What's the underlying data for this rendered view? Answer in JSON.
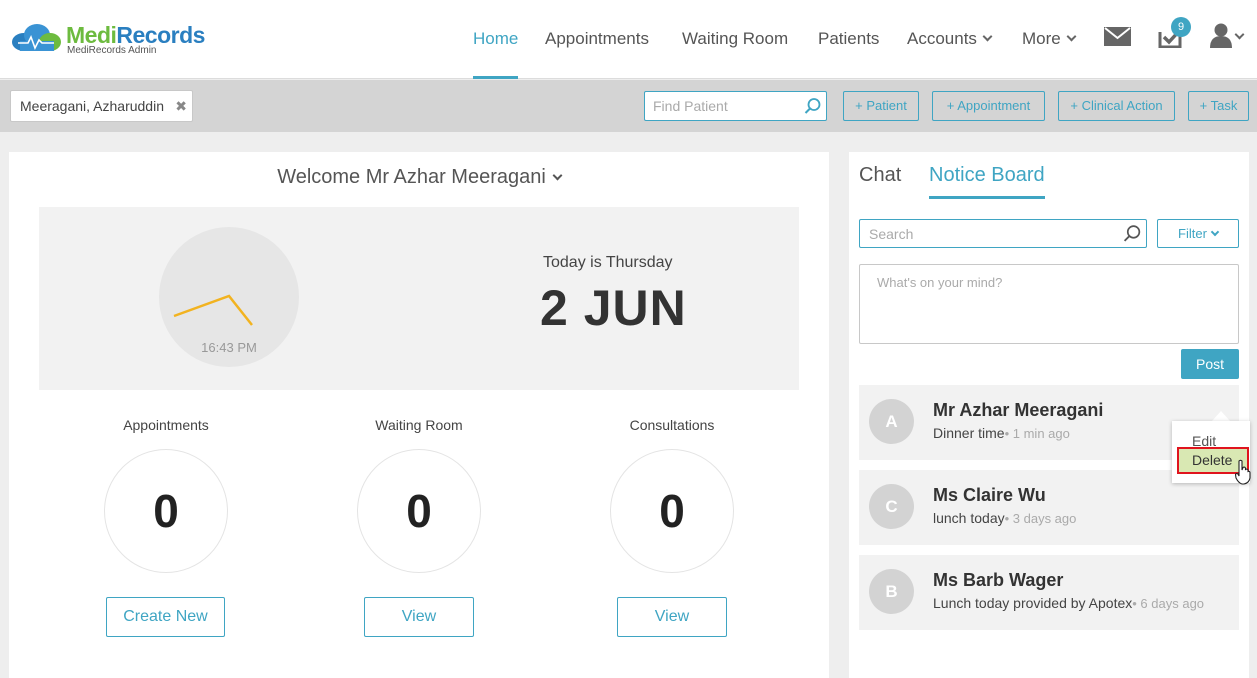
{
  "app": {
    "logo_medi": "Medi",
    "logo_records": "Records",
    "logo_sub": "MediRecords Admin"
  },
  "nav": {
    "home": "Home",
    "appointments": "Appointments",
    "waiting_room": "Waiting Room",
    "patients": "Patients",
    "accounts": "Accounts",
    "more": "More",
    "tasks_badge": "9"
  },
  "toolbar": {
    "patient_name": "Meeragani, Azharuddin",
    "close_glyph": "✖",
    "find_placeholder": "Find Patient",
    "add_patient": "+ Patient",
    "add_appointment": "+ Appointment",
    "add_clinical_action": "+ Clinical Action",
    "add_task": "+ Task"
  },
  "dashboard": {
    "welcome": "Welcome Mr Azhar Meeragani",
    "clock_time": "16:43 PM",
    "today_label": "Today is Thursday",
    "date": "2 JUN",
    "stats": [
      {
        "label": "Appointments",
        "value": "0",
        "button": "Create New"
      },
      {
        "label": "Waiting Room",
        "value": "0",
        "button": "View"
      },
      {
        "label": "Consultations",
        "value": "0",
        "button": "View"
      }
    ]
  },
  "sidebar": {
    "tab_chat": "Chat",
    "tab_notice": "Notice Board",
    "search_placeholder": "Search",
    "filter_label": "Filter",
    "mind_placeholder": "What's on your mind?",
    "post_label": "Post",
    "notices": [
      {
        "initial": "A",
        "name": "Mr Azhar Meeragani",
        "message": "Dinner time",
        "time": "• 1 min ago"
      },
      {
        "initial": "C",
        "name": "Ms Claire Wu",
        "message": "lunch today",
        "time": "• 3 days ago"
      },
      {
        "initial": "B",
        "name": "Ms Barb Wager",
        "message": "Lunch today provided by Apotex",
        "time": "• 6 days ago"
      }
    ],
    "menu_edit": "Edit",
    "menu_delete": "Delete"
  },
  "colors": {
    "accent": "#3fa5c3",
    "logo_green": "#6dbb3f",
    "logo_blue": "#2a7fc0",
    "clock_hand": "#f2b320",
    "highlight_border": "#e0141e"
  }
}
